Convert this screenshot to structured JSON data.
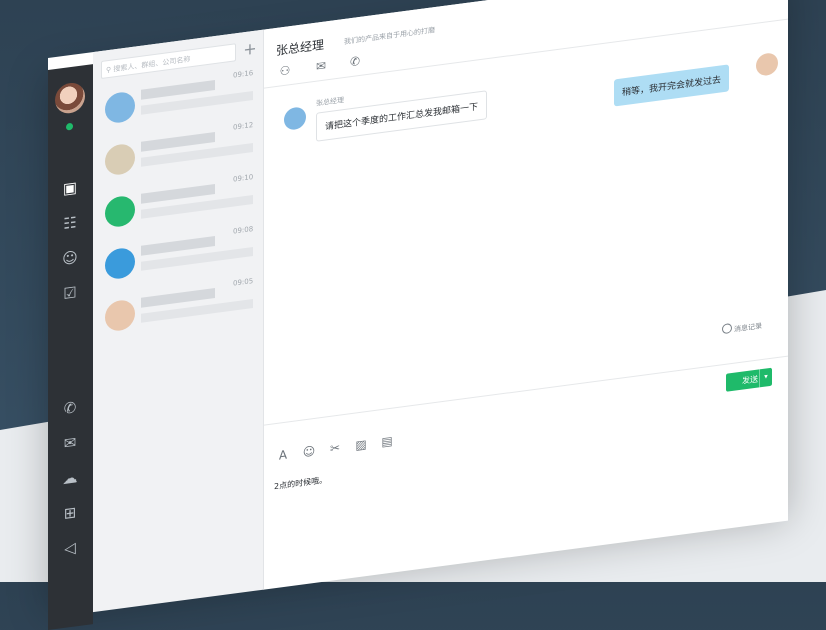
{
  "search": {
    "placeholder": "搜索人、群组、公司名称"
  },
  "add_button": {
    "label": "+"
  },
  "conversations": [
    {
      "time": "09:16",
      "avatar": "#7fb7e3"
    },
    {
      "time": "09:12",
      "avatar": "#d9cdb5"
    },
    {
      "time": "09:10",
      "avatar": "#27b86f"
    },
    {
      "time": "09:08",
      "avatar": "#3a9bdc"
    },
    {
      "time": "09:05",
      "avatar": "#e9c7ad"
    }
  ],
  "header": {
    "name": "张总经理",
    "subtitle": "我们的产品来自于用心的打磨"
  },
  "messages": {
    "incoming": {
      "sender": "张总经理",
      "text": "请把这个季度的工作汇总发我邮箱一下"
    },
    "outgoing": {
      "text": "稍等，我开完会就发过去"
    }
  },
  "history_label": "消息记录",
  "composer": {
    "typed": "2点的时候哦。"
  },
  "send_label": "发送",
  "colors": {
    "accent": "#1fba6a",
    "rail": "#2d3136",
    "bubble_out": "#aeddf4"
  }
}
